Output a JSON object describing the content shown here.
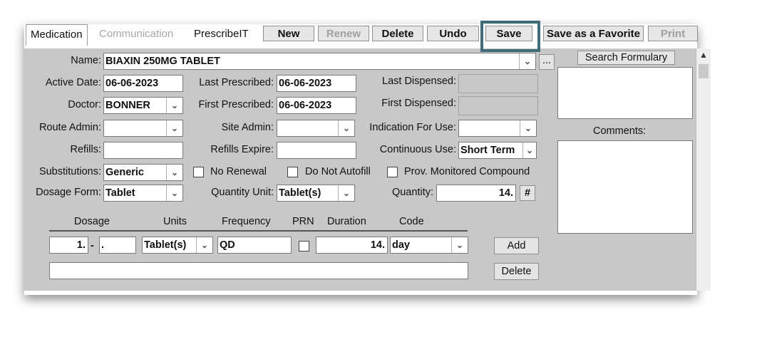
{
  "tabs": [
    {
      "label": "Medication"
    },
    {
      "label": "Communication"
    },
    {
      "label": "PrescribeIT"
    }
  ],
  "toolbar": {
    "new": "New",
    "renew": "Renew",
    "delete": "Delete",
    "undo": "Undo",
    "save": "Save",
    "save_favorite": "Save as a Favorite",
    "print": "Print"
  },
  "form": {
    "name_label": "Name:",
    "name_value": "BIAXIN 250MG TABLET",
    "ellipsis": "...",
    "active_date_label": "Active Date:",
    "active_date_value": "06-06-2023",
    "last_prescribed_label": "Last Prescribed:",
    "last_prescribed_value": "06-06-2023",
    "last_dispensed_label": "Last Dispensed:",
    "doctor_label": "Doctor:",
    "doctor_value": "BONNER",
    "first_prescribed_label": "First Prescribed:",
    "first_prescribed_value": "06-06-2023",
    "first_dispensed_label": "First Dispensed:",
    "route_admin_label": "Route Admin:",
    "site_admin_label": "Site Admin:",
    "indication_label": "Indication For Use:",
    "refills_label": "Refills:",
    "refills_expire_label": "Refills Expire:",
    "continuous_use_label": "Continuous Use:",
    "continuous_use_value": "Short Term",
    "substitutions_label": "Substitutions:",
    "substitutions_value": "Generic",
    "no_renewal_label": "No Renewal",
    "do_not_autofill_label": "Do Not Autofill",
    "prov_monitored_label": "Prov. Monitored Compound",
    "dosage_form_label": "Dosage Form:",
    "dosage_form_value": "Tablet",
    "quantity_unit_label": "Quantity Unit:",
    "quantity_unit_value": "Tablet(s)",
    "quantity_label": "Quantity:",
    "quantity_value": "14.",
    "hash_button": "#"
  },
  "dosage_grid": {
    "headers": {
      "dosage": "Dosage",
      "units": "Units",
      "frequency": "Frequency",
      "prn": "PRN",
      "duration": "Duration",
      "code": "Code"
    },
    "dosage_value": "1.",
    "dash": "-",
    "dosage_value2": ".",
    "units_value": "Tablet(s)",
    "frequency_value": "QD",
    "duration_value": "14.",
    "code_value": "day",
    "add_button": "Add",
    "delete_button": "Delete"
  },
  "right_panel": {
    "search_formulary": "Search Formulary",
    "comments_label": "Comments:"
  },
  "colors": {
    "panel": "#c8c8c8",
    "highlight": "#3f6c78"
  }
}
